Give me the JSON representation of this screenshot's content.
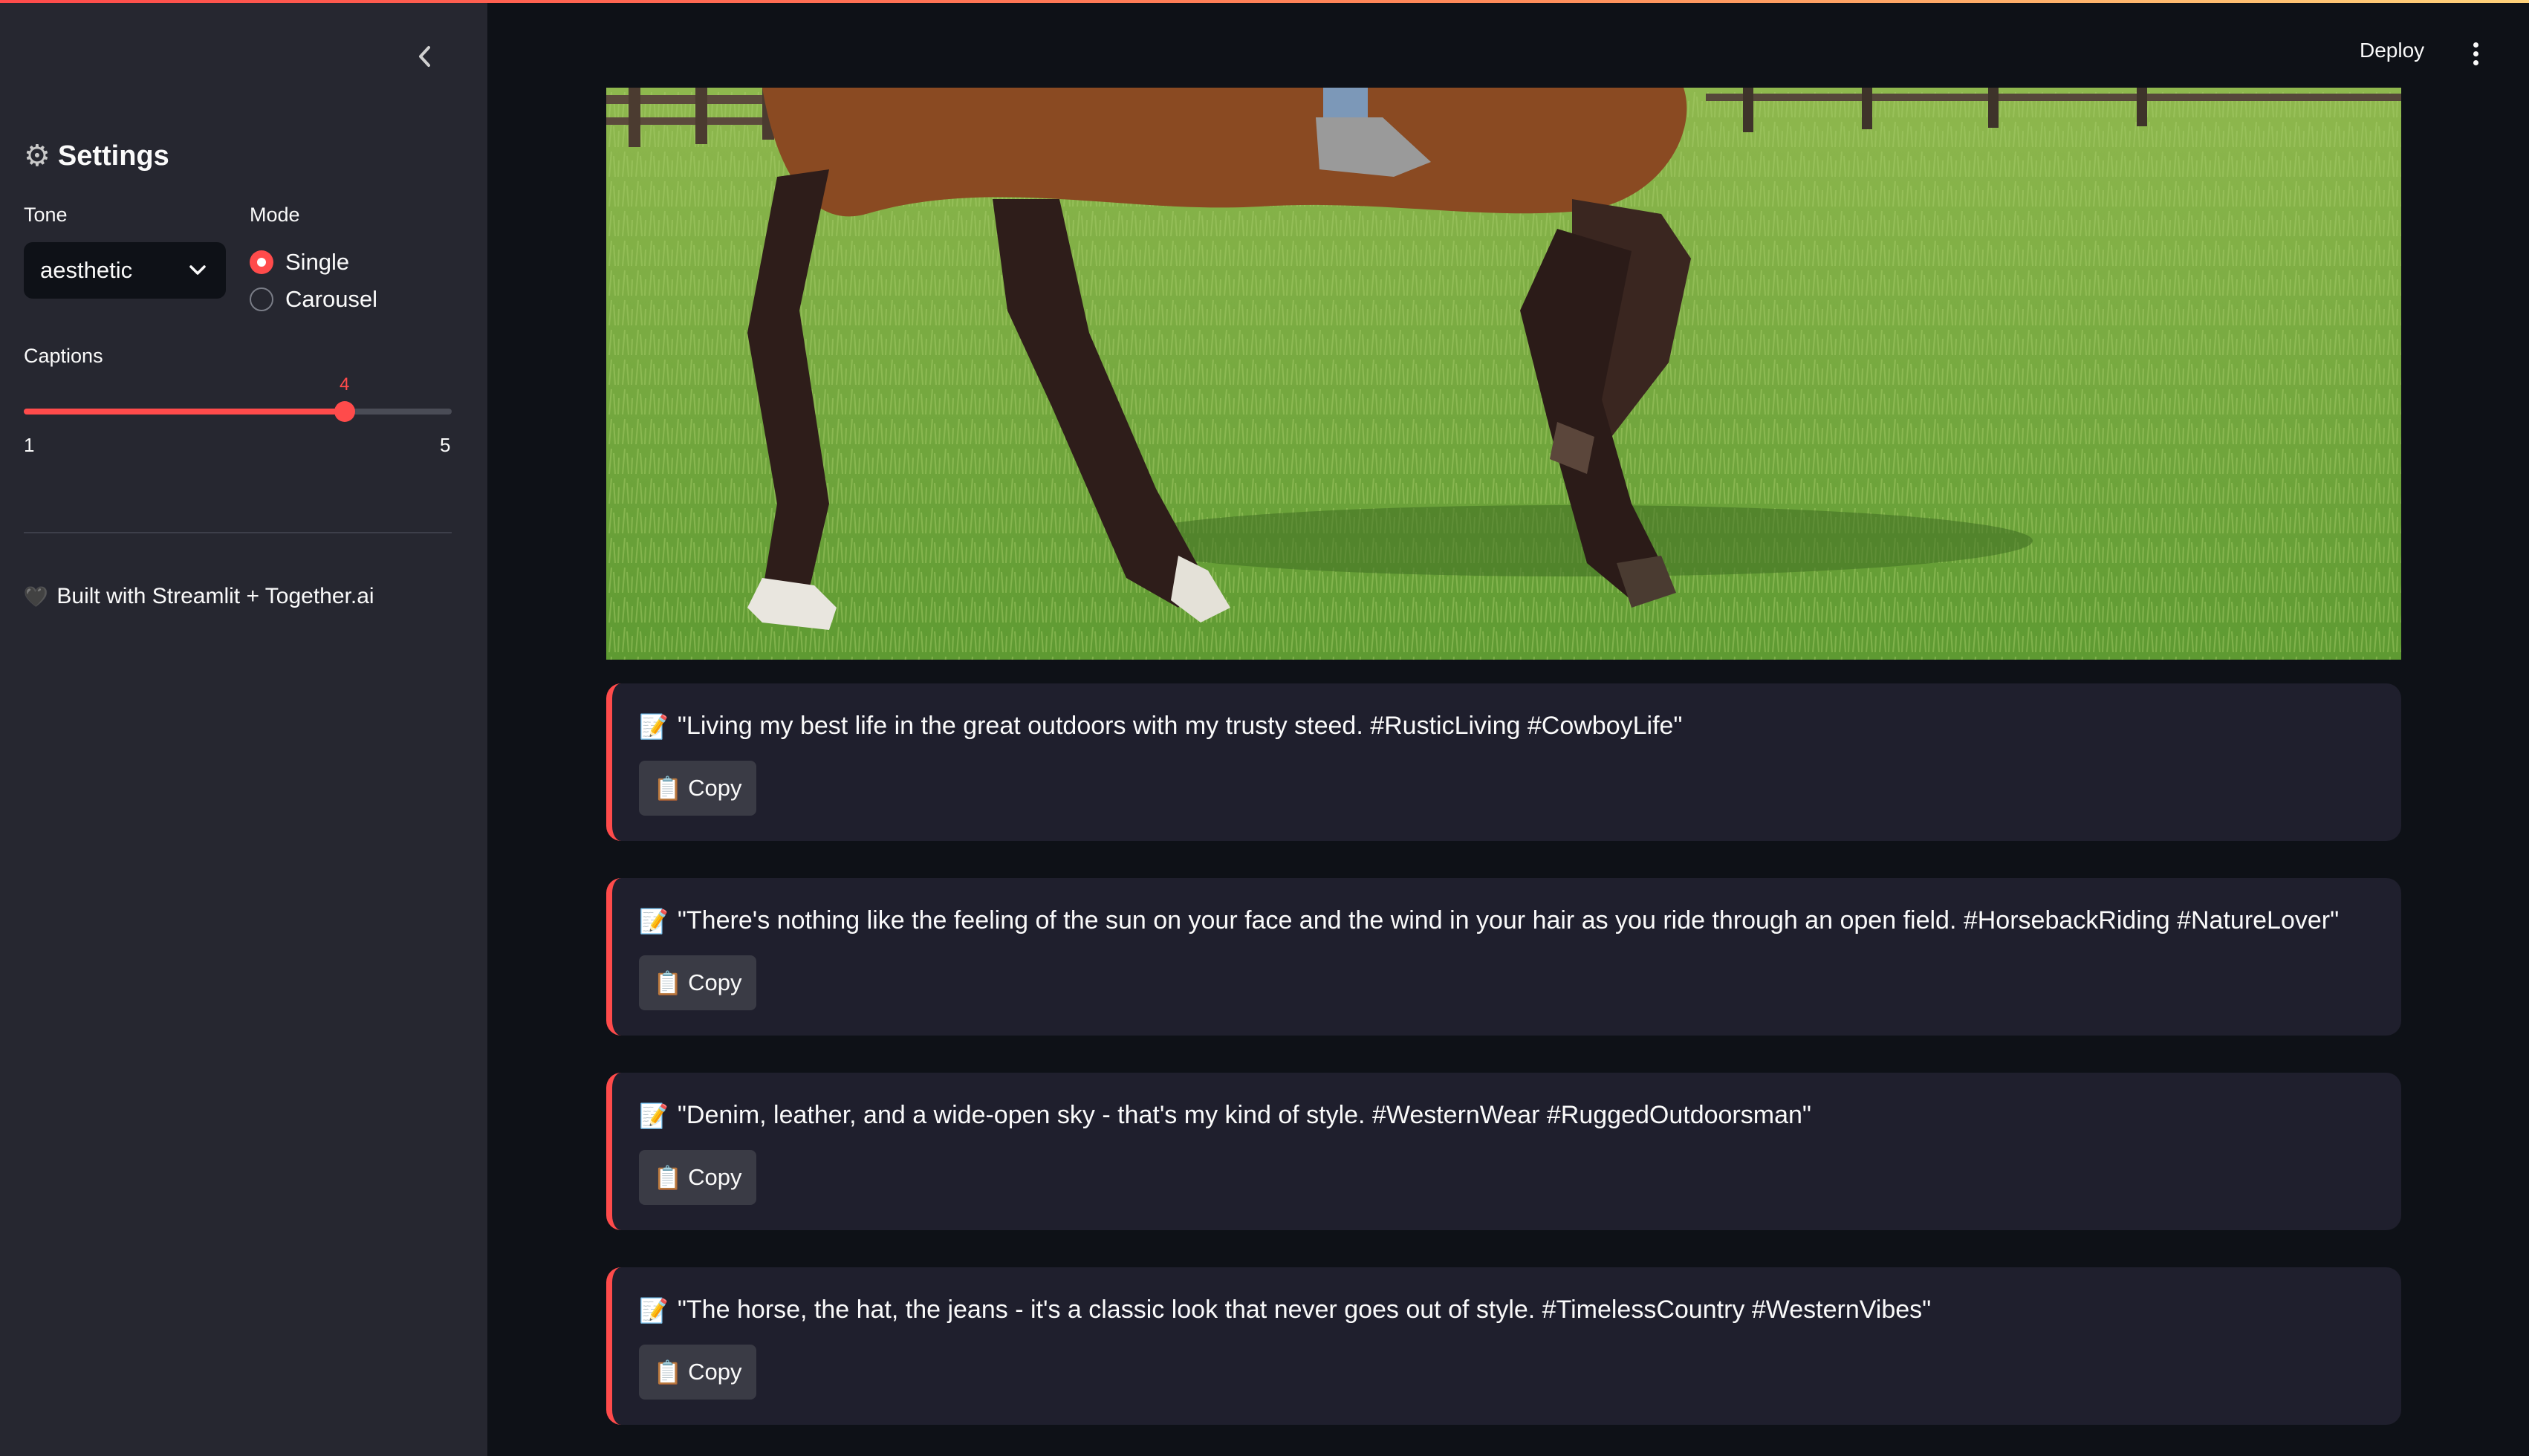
{
  "sidebar": {
    "collapse_icon": "chevron-left-icon",
    "header": {
      "icon": "gear-icon",
      "title": "Settings"
    },
    "tone": {
      "label": "Tone",
      "value": "aesthetic"
    },
    "mode": {
      "label": "Mode",
      "options": [
        "Single",
        "Carousel"
      ],
      "selected": "Single"
    },
    "captions": {
      "label": "Captions",
      "value": "4",
      "min": "1",
      "max": "5",
      "fraction": 0.75
    },
    "footer": {
      "icon": "black-heart-icon",
      "text": "Built with Streamlit + Together.ai"
    }
  },
  "header": {
    "deploy_label": "Deploy",
    "menu_icon": "kebab-menu-icon"
  },
  "image": {
    "subject": "horse-photo"
  },
  "results": {
    "copy_label": "Copy",
    "captions": [
      "\"Living my best life in the great outdoors with my trusty steed. #RusticLiving #CowboyLife\"",
      "\"There's nothing like the feeling of the sun on your face and the wind in your hair as you ride through an open field. #HorsebackRiding #NatureLover\"",
      "\"Denim, leather, and a wide-open sky - that's my kind of style. #WesternWear #RuggedOutdoorsman\"",
      "\"The horse, the hat, the jeans - it's a classic look that never goes out of style. #TimelessCountry #WesternVibes\""
    ]
  },
  "colors": {
    "accent": "#ff4b4b",
    "background": "#0e1117",
    "sidebar": "#262730",
    "card": "#1f1f2d"
  }
}
